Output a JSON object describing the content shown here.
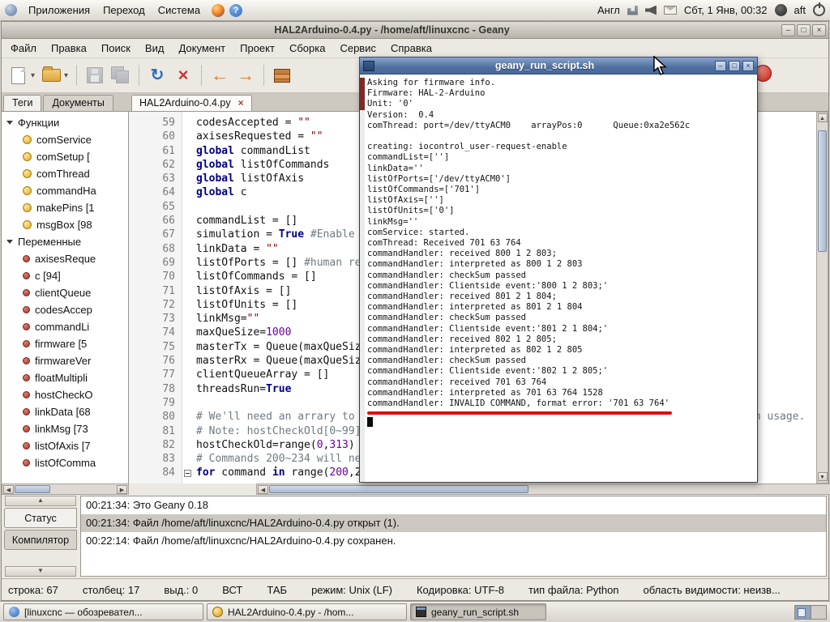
{
  "icons": {
    "dropdown": "▾",
    "minimize": "–",
    "maximize": "□",
    "close": "×",
    "back": "←",
    "forward": "→",
    "reload": "↻",
    "scroll_up": "▲",
    "scroll_down": "▼",
    "scroll_left": "◀",
    "scroll_right": "▶",
    "help": "?"
  },
  "panel": {
    "menus": [
      "Приложения",
      "Переход",
      "Система"
    ],
    "tray": {
      "keyboard": "Англ",
      "clock": "Сбт, 1 Янв, 00:32",
      "user": "aft"
    }
  },
  "geany": {
    "title": "HAL2Arduino-0.4.py - /home/aft/linuxcnc - Geany",
    "menubar": [
      "Файл",
      "Правка",
      "Поиск",
      "Вид",
      "Документ",
      "Проект",
      "Сборка",
      "Сервис",
      "Справка"
    ],
    "sidebar": {
      "tabs": [
        "Теги",
        "Документы"
      ],
      "sections": [
        {
          "label": "Функции",
          "kind": "function",
          "items": [
            "comService",
            "comSetup [",
            "comThread",
            "commandHa",
            "makePins [1",
            "msgBox [98"
          ]
        },
        {
          "label": "Переменные",
          "kind": "variable",
          "items": [
            "axisesReque",
            "c [94]",
            "clientQueue",
            "codesAccep",
            "commandLi",
            "firmware [5",
            "firmwareVer",
            "floatMultipli",
            "hostCheckO",
            "linkData [68",
            "linkMsg [73",
            "listOfAxis [7",
            "listOfComma"
          ]
        }
      ]
    },
    "doc_tab": "HAL2Arduino-0.4.py",
    "editor": {
      "lines": [
        {
          "n": 59,
          "s": [
            [
              "p",
              "codesAccepted = "
            ],
            [
              "s",
              "\"\""
            ]
          ]
        },
        {
          "n": 60,
          "s": [
            [
              "p",
              "axisesRequested = "
            ],
            [
              "s",
              "\"\""
            ]
          ]
        },
        {
          "n": 61,
          "s": [
            [
              "k",
              "global"
            ],
            [
              "p",
              " commandList"
            ]
          ]
        },
        {
          "n": 62,
          "s": [
            [
              "k",
              "global"
            ],
            [
              "p",
              " listOfCommands"
            ]
          ]
        },
        {
          "n": 63,
          "s": [
            [
              "k",
              "global"
            ],
            [
              "p",
              " listOfAxis"
            ]
          ]
        },
        {
          "n": 64,
          "s": [
            [
              "k",
              "global"
            ],
            [
              "p",
              " c"
            ]
          ]
        },
        {
          "n": 65,
          "s": []
        },
        {
          "n": 66,
          "s": [
            [
              "p",
              "commandList = []"
            ]
          ]
        },
        {
          "n": 67,
          "s": [
            [
              "p",
              "simulation = "
            ],
            [
              "k",
              "True"
            ],
            [
              "p",
              " "
            ],
            [
              "c",
              "#Enable simulation mode."
            ]
          ]
        },
        {
          "n": 68,
          "s": [
            [
              "p",
              "linkData = "
            ],
            [
              "s",
              "\"\""
            ]
          ]
        },
        {
          "n": 69,
          "s": [
            [
              "p",
              "listOfPorts = [] "
            ],
            [
              "c",
              "#human readable port names"
            ]
          ]
        },
        {
          "n": 70,
          "s": [
            [
              "p",
              "listOfCommands = []"
            ]
          ]
        },
        {
          "n": 71,
          "s": [
            [
              "p",
              "listOfAxis = []"
            ]
          ]
        },
        {
          "n": 72,
          "s": [
            [
              "p",
              "listOfUnits = []"
            ]
          ]
        },
        {
          "n": 73,
          "s": [
            [
              "p",
              "linkMsg="
            ],
            [
              "s",
              "\"\""
            ]
          ]
        },
        {
          "n": 74,
          "s": [
            [
              "p",
              "maxQueSize="
            ],
            [
              "n",
              "1000"
            ]
          ]
        },
        {
          "n": 75,
          "s": [
            [
              "p",
              "masterTx = Queue(maxQueSize)"
            ]
          ]
        },
        {
          "n": 76,
          "s": [
            [
              "p",
              "masterRx = Queue(maxQueSize)"
            ]
          ]
        },
        {
          "n": 77,
          "s": [
            [
              "p",
              "clientQueueArray = []"
            ]
          ]
        },
        {
          "n": 78,
          "s": [
            [
              "p",
              "threadsRun="
            ],
            [
              "k",
              "True"
            ]
          ]
        },
        {
          "n": 79,
          "s": []
        },
        {
          "n": 80,
          "s": [
            [
              "c",
              "# We'll need an arrary to store a copy of all of the old hostCheck values, for comparison usage."
            ]
          ]
        },
        {
          "n": 81,
          "s": [
            [
              "c",
              "# Note: hostCheckOld[0~99] is reserved."
            ]
          ]
        },
        {
          "n": 82,
          "s": [
            [
              "p",
              "hostCheckOld=range("
            ],
            [
              "n",
              "0"
            ],
            [
              "p",
              ","
            ],
            [
              "n",
              "313"
            ],
            [
              "p",
              ")"
            ]
          ]
        },
        {
          "n": 83,
          "s": [
            [
              "c",
              "# Commands 200~234 will need handling."
            ]
          ]
        },
        {
          "n": 84,
          "fold": true,
          "s": [
            [
              "k",
              "for"
            ],
            [
              "p",
              " command "
            ],
            [
              "k",
              "in"
            ],
            [
              "p",
              " range("
            ],
            [
              "n",
              "200"
            ],
            [
              "p",
              ",235):"
            ]
          ]
        }
      ]
    },
    "messages": {
      "tabs": [
        "Статус",
        "Компилятор"
      ],
      "rows": [
        {
          "text": "00:21:34: Это Geany 0.18",
          "sel": false
        },
        {
          "text": "00:21:34: Файл /home/aft/linuxcnc/HAL2Arduino-0.4.py открыт (1).",
          "sel": true
        },
        {
          "text": "00:22:14: Файл /home/aft/linuxcnc/HAL2Arduino-0.4.py сохранен.",
          "sel": false
        }
      ]
    },
    "statusbar": [
      "строка: 67",
      "столбец: 17",
      "выд.: 0",
      "ВСТ",
      "ТАБ",
      "режим: Unix (LF)",
      "Кодировка: UTF-8",
      "тип файла: Python",
      "область видимости: неизв..."
    ]
  },
  "terminal": {
    "title": "geany_run_script.sh",
    "lines": [
      "Asking for firmware info.",
      "Firmware: HAL-2-Arduino",
      "Unit: '0'",
      "Version:  0.4",
      "comThread: port=/dev/ttyACM0    arrayPos:0      Queue:0xa2e562c",
      "",
      "creating: iocontrol_user-request-enable",
      "commandList=['']",
      "linkData=''",
      "listOfPorts=['/dev/ttyACM0']",
      "listOfCommands=['701']",
      "listOfAxis=['']",
      "listOfUnits=['0']",
      "linkMsg=''",
      "comService: started.",
      "comThread: Received 701 63 764",
      "commandHandler: received 800 1 2 803;",
      "commandHandler: interpreted as 800 1 2 803",
      "commandHandler: checkSum passed",
      "commandHandler: Clientside event:'800 1 2 803;'",
      "commandHandler: received 801 2 1 804;",
      "commandHandler: interpreted as 801 2 1 804",
      "commandHandler: checkSum passed",
      "commandHandler: Clientside event:'801 2 1 804;'",
      "commandHandler: received 802 1 2 805;",
      "commandHandler: interpreted as 802 1 2 805",
      "commandHandler: checkSum passed",
      "commandHandler: Clientside event:'802 1 2 805;'",
      "commandHandler: received 701 63 764",
      "commandHandler: interpreted as 701 63 764 1528",
      "commandHandler: INVALID COMMAND, format error: '701 63 764'"
    ]
  },
  "taskbar": {
    "buttons": [
      {
        "label": "[linuxcnc — обозревател...",
        "icon": "globe",
        "active": false
      },
      {
        "label": "HAL2Arduino-0.4.py - /hom...",
        "icon": "geany",
        "active": false
      },
      {
        "label": "geany_run_script.sh",
        "icon": "term",
        "active": true
      }
    ]
  }
}
